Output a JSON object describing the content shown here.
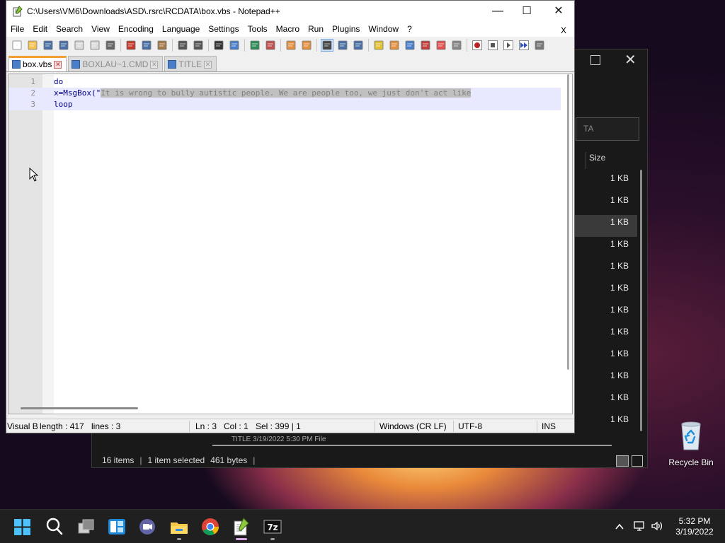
{
  "explorer": {
    "search_fragment": "TA",
    "column_size": "Size",
    "sizes": [
      "1 KB",
      "1 KB",
      "1 KB",
      "1 KB",
      "1 KB",
      "1 KB",
      "1 KB",
      "1 KB",
      "1 KB",
      "1 KB",
      "1 KB",
      "1 KB"
    ],
    "selected_row_index": 2,
    "partial_row": "TITLE          3/19/2022 5:30 PM          File",
    "status_items": "16 items",
    "status_selected": "1 item selected",
    "status_size": "461 bytes",
    "status_sep": "|"
  },
  "npp": {
    "title": "C:\\Users\\VM6\\Downloads\\ASD\\.rsrc\\RCDATA\\box.vbs - Notepad++",
    "window_min": "—",
    "window_max": "☐",
    "window_close": "✕",
    "menu": [
      "File",
      "Edit",
      "Search",
      "View",
      "Encoding",
      "Language",
      "Settings",
      "Tools",
      "Macro",
      "Run",
      "Plugins",
      "Window",
      "?"
    ],
    "menu_close": "X",
    "tabs": [
      {
        "label": "box.vbs",
        "active": true
      },
      {
        "label": "BOXLAU~1.CMD",
        "active": false
      },
      {
        "label": "TITLE",
        "active": false
      }
    ],
    "lines": [
      {
        "num": "1",
        "code": "do"
      },
      {
        "num": "2",
        "prefix": "x=MsgBox(\"",
        "string": "It is wrong to bully autistic people. We are people too, we just don't act like"
      },
      {
        "num": "3",
        "code": "loop"
      }
    ],
    "status": {
      "lang": "Visual B",
      "length": "length : 417",
      "lines": "lines : 3",
      "ln": "Ln : 3",
      "col": "Col : 1",
      "sel": "Sel : 399 | 1",
      "eol": "Windows (CR LF)",
      "enc": "UTF-8",
      "mode": "INS"
    }
  },
  "desktop": {
    "recycle_bin": "Recycle Bin"
  },
  "taskbar": {
    "time": "5:32 PM",
    "date": "3/19/2022"
  }
}
